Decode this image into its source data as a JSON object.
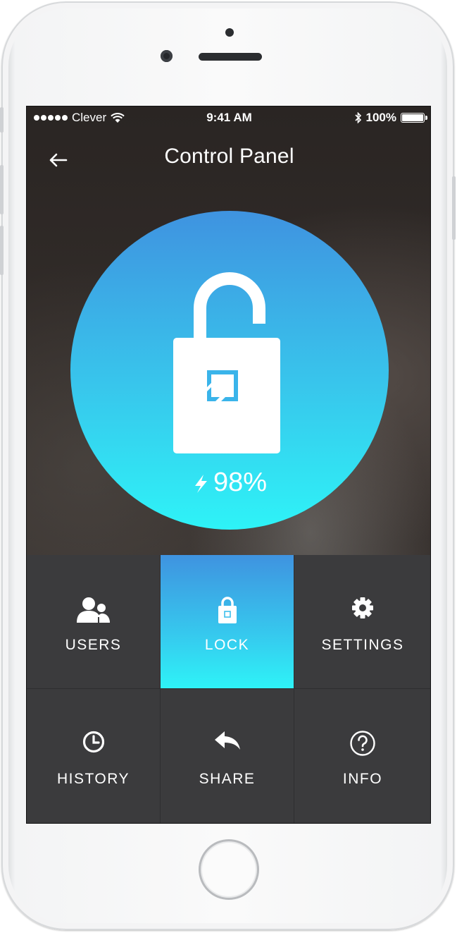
{
  "status_bar": {
    "carrier": "Clever",
    "time": "9:41 AM",
    "battery_percent": "100%"
  },
  "header": {
    "title": "Control Panel",
    "back_icon": "arrow-left-icon"
  },
  "lock_status": {
    "state": "unlocked",
    "battery_label": "98%",
    "battery_level": 0.98,
    "colors": {
      "gradient_top": "#3f93e0",
      "gradient_bottom": "#2ef3f7"
    }
  },
  "menu": {
    "users": {
      "label": "USERS",
      "icon": "users-icon"
    },
    "lock": {
      "label": "LOCK",
      "icon": "lock-icon",
      "active": true
    },
    "settings": {
      "label": "SETTINGS",
      "icon": "gear-icon"
    },
    "history": {
      "label": "HISTORY",
      "icon": "clock-icon"
    },
    "share": {
      "label": "SHARE",
      "icon": "share-icon"
    },
    "info": {
      "label": "INFO",
      "icon": "question-icon"
    }
  },
  "colors": {
    "cell_background": "#3b3b3d",
    "accent": "#38c6ec"
  }
}
